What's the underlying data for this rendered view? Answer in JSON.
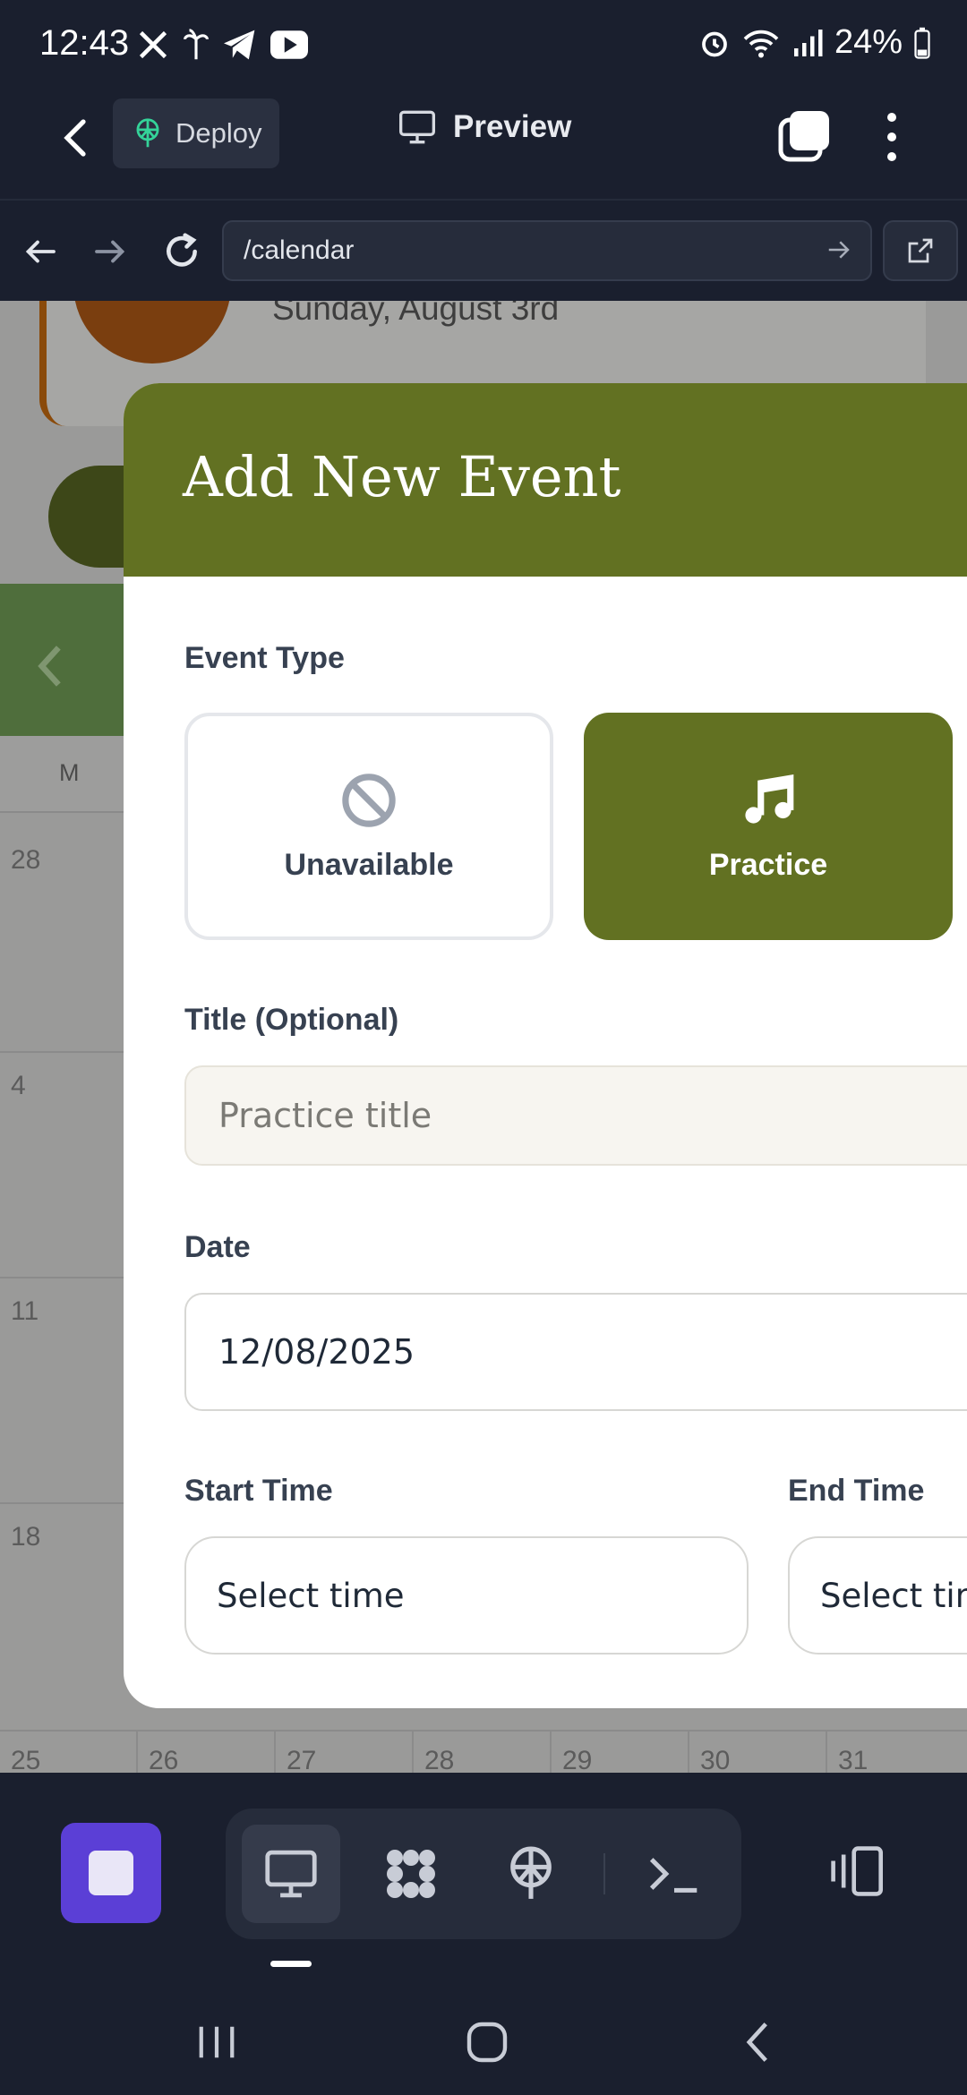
{
  "status_bar": {
    "time": "12:43",
    "battery": "24%"
  },
  "app_bar": {
    "deploy_label": "Deploy",
    "preview_label": "Preview"
  },
  "url_bar": {
    "url": "/calendar"
  },
  "background": {
    "date_text": "Sunday, August 3rd",
    "weekday_header": "M",
    "week_starts": [
      "28",
      "4",
      "11",
      "18"
    ],
    "last_row_dates": [
      "25",
      "26",
      "27",
      "28",
      "29",
      "30",
      "31"
    ]
  },
  "modal": {
    "title": "Add New Event",
    "event_type_label": "Event Type",
    "event_types": [
      {
        "label": "Unavailable",
        "icon": "ban-icon",
        "selected": false
      },
      {
        "label": "Practice",
        "icon": "music-note-icon",
        "selected": true
      }
    ],
    "title_label": "Title (Optional)",
    "title_placeholder": "Practice title",
    "date_label": "Date",
    "date_value": "12/08/2025",
    "start_time_label": "Start Time",
    "start_time_value": "Select time",
    "end_time_label": "End Time",
    "end_time_value": "Select time"
  },
  "colors": {
    "accent": "#627122",
    "toolbar_active": "#5b3fd6",
    "background_dark": "#1a1f2e"
  },
  "toolbar": {
    "tools": [
      "monitor-icon",
      "blocks-icon",
      "deploy-icon",
      "terminal-icon"
    ]
  }
}
